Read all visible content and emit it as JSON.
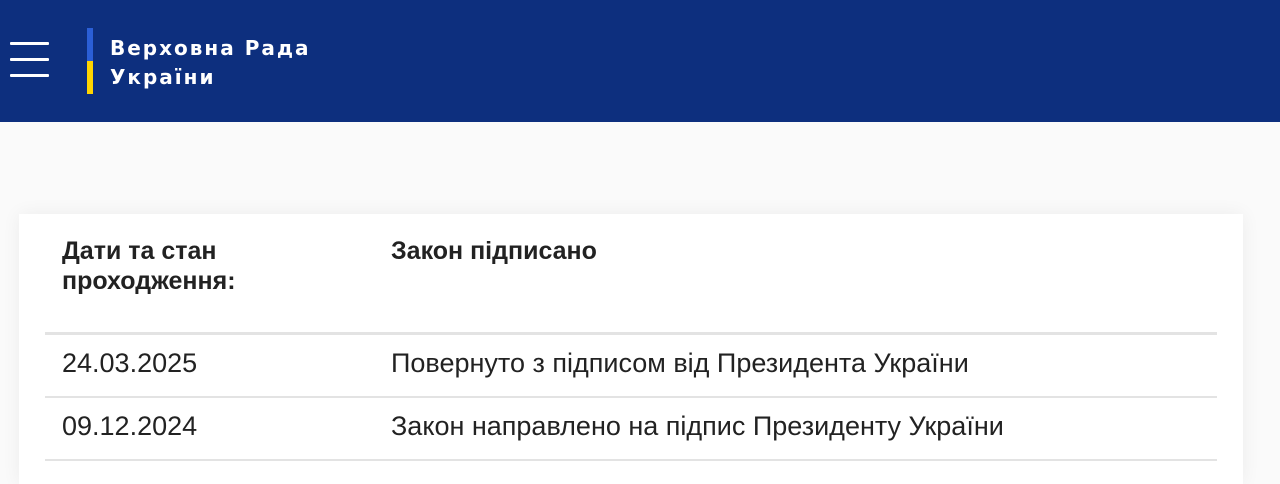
{
  "header": {
    "menu_icon": "hamburger-menu-icon",
    "logo_line1": "Верховна Рада",
    "logo_line2": "України",
    "colors": {
      "background": "#0d2f7e",
      "flag_blue": "#2b5fd6",
      "flag_yellow": "#ffd500"
    }
  },
  "status_table": {
    "header": {
      "label": "Дати та стан проходження:",
      "value": "Закон підписано"
    },
    "rows": [
      {
        "date": "24.03.2025",
        "event": "Повернуто з підписом від Президента України"
      },
      {
        "date": "09.12.2024",
        "event": "Закон направлено на підпис Президенту України"
      }
    ]
  }
}
